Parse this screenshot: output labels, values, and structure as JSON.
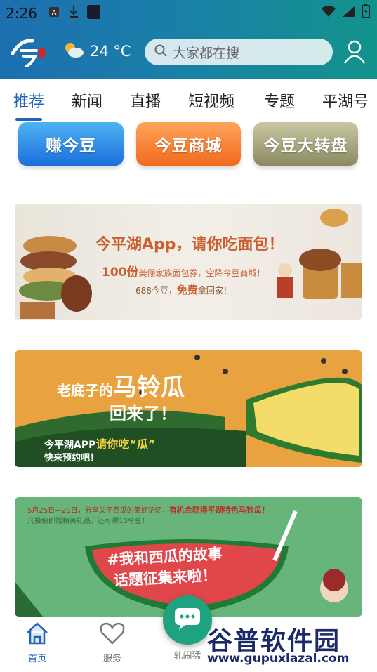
{
  "status_bar": {
    "time": "2:26"
  },
  "header": {
    "weather_temp": "24 °C",
    "search_placeholder": "大家都在搜"
  },
  "tabs": [
    {
      "label": "推荐",
      "active": true
    },
    {
      "label": "新闻"
    },
    {
      "label": "直播"
    },
    {
      "label": "短视频"
    },
    {
      "label": "专题"
    },
    {
      "label": "平湖号"
    }
  ],
  "coin_buttons": [
    {
      "label": "赚今豆"
    },
    {
      "label": "今豆商城"
    },
    {
      "label": "今豆大转盘"
    }
  ],
  "banners": {
    "bread": {
      "title": "今平湖App，请你吃面包！",
      "line2_prefix": "100份",
      "line2_rest": "美俪家族面包券，空降今豆商城！",
      "line3_prefix": "688今豆，",
      "line3_bold": "免费",
      "line3_rest": "拿回家！"
    },
    "melon": {
      "line1_prefix": "老底子的",
      "line1_big": "马铃瓜",
      "line2": "回来了！",
      "line3_prefix": "今平湖APP",
      "line3_highlight": "请你吃“瓜”",
      "line4": "快来预约吧！"
    },
    "watermelon": {
      "note1": "5月25日—29日，分享关于西瓜的美好记忆，",
      "note1_highlight": "有机会获得平湖特色马铃瓜！",
      "note2": "凡投稿即赠精美礼品，还可得10今豆！",
      "headline1": "#我和西瓜的故事",
      "headline2": "话题征集来啦！"
    }
  },
  "bottom_nav": [
    {
      "label": "首页",
      "active": true
    },
    {
      "label": "服务"
    },
    {
      "label": "轧闹猛"
    }
  ],
  "watermark": {
    "name": "谷普软件园",
    "url": "www.gupuxlazal.com"
  },
  "colors": {
    "accent": "#2164b8",
    "header_start": "#1d6fb0",
    "header_end": "#12938c"
  }
}
